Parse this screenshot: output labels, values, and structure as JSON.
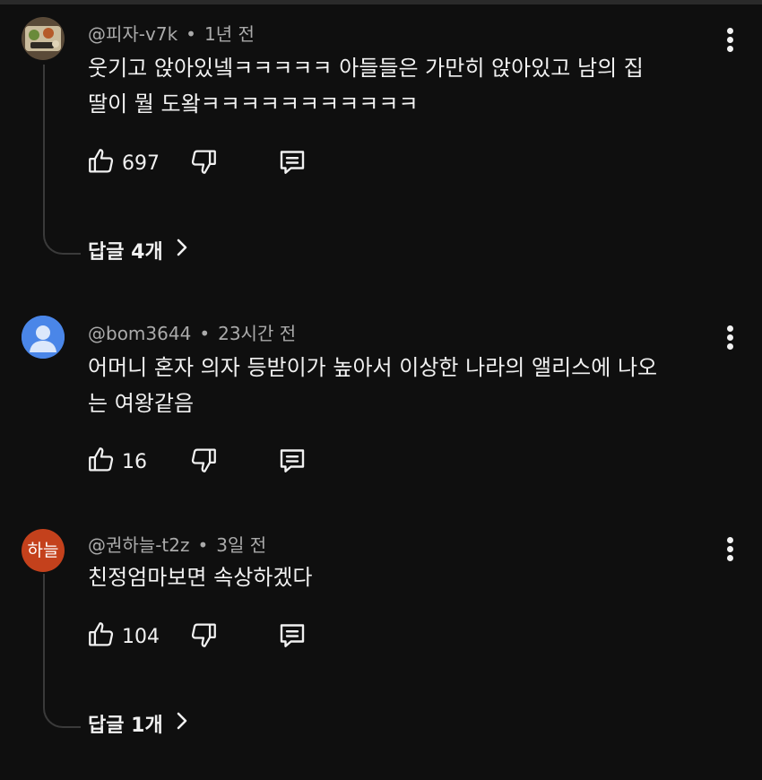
{
  "comments": [
    {
      "author": "@피자-v7k",
      "time": "1년 전",
      "text_lines": [
        "웃기고 앉아있넼ㅋㅋㅋㅋㅋ 아들들은 가만히 앉아있고 남의 집",
        "딸이 뭘 도왘ㅋㅋㅋㅋㅋㅋㅋㅋㅋㅋㅋ"
      ],
      "likes": "697",
      "replies_label": "답글 4개",
      "avatar": "food-photo-avatar"
    },
    {
      "author": "@bom3644",
      "time": "23시간 전",
      "text_lines": [
        "어머니 혼자 의자 등받이가 높아서 이상한 나라의 앨리스에 나오",
        "는 여왕같음"
      ],
      "likes": "16",
      "avatar": "default-person-avatar"
    },
    {
      "author": "@권하늘-t2z",
      "time": "3일 전",
      "text_lines": [
        "친정엄마보면 속상하겠다"
      ],
      "likes": "104",
      "replies_label": "답글 1개",
      "avatar_text": "하늘"
    }
  ],
  "separator": "•",
  "colors": {
    "background": "#0f0f0f",
    "text": "#f1f1f1",
    "meta": "#aaaaaa",
    "avatar_blue": "#4a86e8",
    "avatar_orange": "#c4411c"
  },
  "icons": [
    "thumbs-up-icon",
    "thumbs-down-icon",
    "reply-icon",
    "more-vert-icon",
    "chevron-right-icon"
  ]
}
